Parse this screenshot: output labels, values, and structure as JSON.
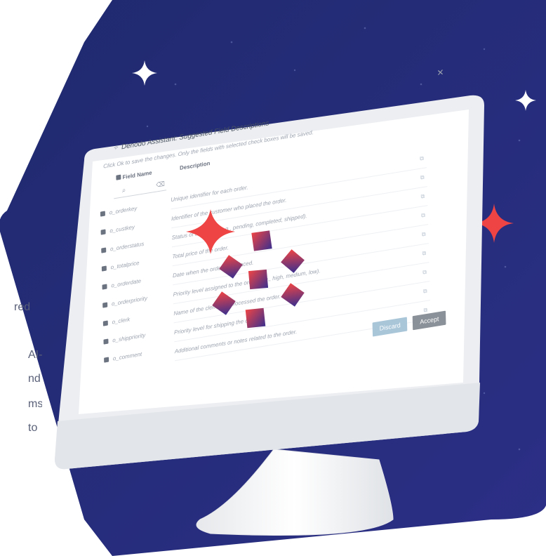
{
  "side_text": [
    "red",
    "AI-",
    "nd",
    "ms",
    "to"
  ],
  "dialog": {
    "title": "Denodo Assistant: Suggested Field Descriptions",
    "close": "✕",
    "hint": "Click Ok to save the changes. Only the fields with selected check boxes will be saved.",
    "col_field": "Field Name",
    "col_description": "Description",
    "search_icon": "search-icon",
    "clear_icon": "clear-icon",
    "fields": [
      "o_orderkey",
      "o_custkey",
      "o_orderstatus",
      "o_totalprice",
      "o_orderdate",
      "o_orderpriority",
      "o_clerk",
      "o_shippriority",
      "o_comment"
    ],
    "descriptions": [
      "Unique identifier for each order.",
      "Identifier of the customer who placed the order.",
      "Status of the order (e.g., pending, completed, shipped).",
      "Total price of the order.",
      "Date when the order was placed.",
      "Priority level assigned to the order (e.g., high, medium, low).",
      "Name of the clerk who processed the order.",
      "Priority level for shipping the order.",
      "Additional comments or notes related to the order."
    ],
    "discard_label": "Discard",
    "accept_label": "Accept"
  },
  "colors": {
    "navy": "#27307a",
    "accent_red": "#ef4444",
    "monitor": "#f2f3f5"
  }
}
